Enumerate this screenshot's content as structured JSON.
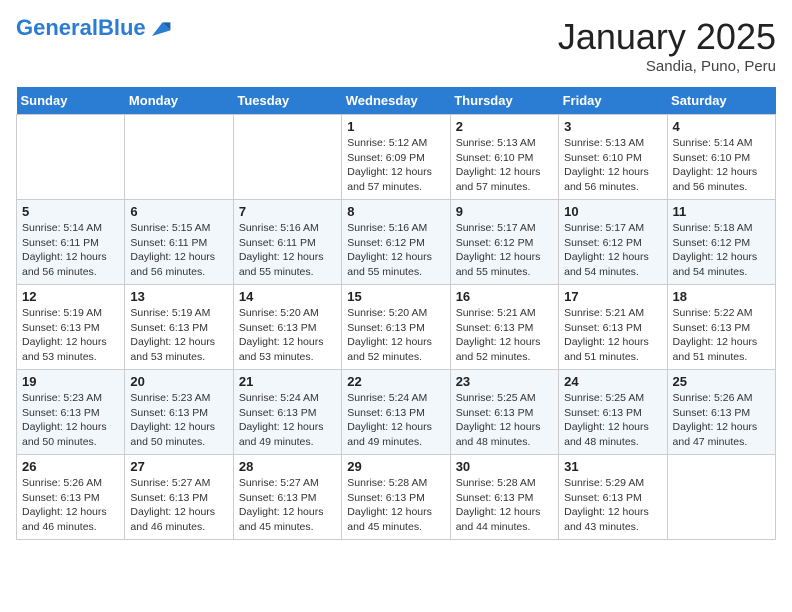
{
  "header": {
    "logo_general": "General",
    "logo_blue": "Blue",
    "month_title": "January 2025",
    "subtitle": "Sandia, Puno, Peru"
  },
  "weekdays": [
    "Sunday",
    "Monday",
    "Tuesday",
    "Wednesday",
    "Thursday",
    "Friday",
    "Saturday"
  ],
  "weeks": [
    [
      {
        "day": "",
        "info": ""
      },
      {
        "day": "",
        "info": ""
      },
      {
        "day": "",
        "info": ""
      },
      {
        "day": "1",
        "info": "Sunrise: 5:12 AM\nSunset: 6:09 PM\nDaylight: 12 hours\nand 57 minutes."
      },
      {
        "day": "2",
        "info": "Sunrise: 5:13 AM\nSunset: 6:10 PM\nDaylight: 12 hours\nand 57 minutes."
      },
      {
        "day": "3",
        "info": "Sunrise: 5:13 AM\nSunset: 6:10 PM\nDaylight: 12 hours\nand 56 minutes."
      },
      {
        "day": "4",
        "info": "Sunrise: 5:14 AM\nSunset: 6:10 PM\nDaylight: 12 hours\nand 56 minutes."
      }
    ],
    [
      {
        "day": "5",
        "info": "Sunrise: 5:14 AM\nSunset: 6:11 PM\nDaylight: 12 hours\nand 56 minutes."
      },
      {
        "day": "6",
        "info": "Sunrise: 5:15 AM\nSunset: 6:11 PM\nDaylight: 12 hours\nand 56 minutes."
      },
      {
        "day": "7",
        "info": "Sunrise: 5:16 AM\nSunset: 6:11 PM\nDaylight: 12 hours\nand 55 minutes."
      },
      {
        "day": "8",
        "info": "Sunrise: 5:16 AM\nSunset: 6:12 PM\nDaylight: 12 hours\nand 55 minutes."
      },
      {
        "day": "9",
        "info": "Sunrise: 5:17 AM\nSunset: 6:12 PM\nDaylight: 12 hours\nand 55 minutes."
      },
      {
        "day": "10",
        "info": "Sunrise: 5:17 AM\nSunset: 6:12 PM\nDaylight: 12 hours\nand 54 minutes."
      },
      {
        "day": "11",
        "info": "Sunrise: 5:18 AM\nSunset: 6:12 PM\nDaylight: 12 hours\nand 54 minutes."
      }
    ],
    [
      {
        "day": "12",
        "info": "Sunrise: 5:19 AM\nSunset: 6:13 PM\nDaylight: 12 hours\nand 53 minutes."
      },
      {
        "day": "13",
        "info": "Sunrise: 5:19 AM\nSunset: 6:13 PM\nDaylight: 12 hours\nand 53 minutes."
      },
      {
        "day": "14",
        "info": "Sunrise: 5:20 AM\nSunset: 6:13 PM\nDaylight: 12 hours\nand 53 minutes."
      },
      {
        "day": "15",
        "info": "Sunrise: 5:20 AM\nSunset: 6:13 PM\nDaylight: 12 hours\nand 52 minutes."
      },
      {
        "day": "16",
        "info": "Sunrise: 5:21 AM\nSunset: 6:13 PM\nDaylight: 12 hours\nand 52 minutes."
      },
      {
        "day": "17",
        "info": "Sunrise: 5:21 AM\nSunset: 6:13 PM\nDaylight: 12 hours\nand 51 minutes."
      },
      {
        "day": "18",
        "info": "Sunrise: 5:22 AM\nSunset: 6:13 PM\nDaylight: 12 hours\nand 51 minutes."
      }
    ],
    [
      {
        "day": "19",
        "info": "Sunrise: 5:23 AM\nSunset: 6:13 PM\nDaylight: 12 hours\nand 50 minutes."
      },
      {
        "day": "20",
        "info": "Sunrise: 5:23 AM\nSunset: 6:13 PM\nDaylight: 12 hours\nand 50 minutes."
      },
      {
        "day": "21",
        "info": "Sunrise: 5:24 AM\nSunset: 6:13 PM\nDaylight: 12 hours\nand 49 minutes."
      },
      {
        "day": "22",
        "info": "Sunrise: 5:24 AM\nSunset: 6:13 PM\nDaylight: 12 hours\nand 49 minutes."
      },
      {
        "day": "23",
        "info": "Sunrise: 5:25 AM\nSunset: 6:13 PM\nDaylight: 12 hours\nand 48 minutes."
      },
      {
        "day": "24",
        "info": "Sunrise: 5:25 AM\nSunset: 6:13 PM\nDaylight: 12 hours\nand 48 minutes."
      },
      {
        "day": "25",
        "info": "Sunrise: 5:26 AM\nSunset: 6:13 PM\nDaylight: 12 hours\nand 47 minutes."
      }
    ],
    [
      {
        "day": "26",
        "info": "Sunrise: 5:26 AM\nSunset: 6:13 PM\nDaylight: 12 hours\nand 46 minutes."
      },
      {
        "day": "27",
        "info": "Sunrise: 5:27 AM\nSunset: 6:13 PM\nDaylight: 12 hours\nand 46 minutes."
      },
      {
        "day": "28",
        "info": "Sunrise: 5:27 AM\nSunset: 6:13 PM\nDaylight: 12 hours\nand 45 minutes."
      },
      {
        "day": "29",
        "info": "Sunrise: 5:28 AM\nSunset: 6:13 PM\nDaylight: 12 hours\nand 45 minutes."
      },
      {
        "day": "30",
        "info": "Sunrise: 5:28 AM\nSunset: 6:13 PM\nDaylight: 12 hours\nand 44 minutes."
      },
      {
        "day": "31",
        "info": "Sunrise: 5:29 AM\nSunset: 6:13 PM\nDaylight: 12 hours\nand 43 minutes."
      },
      {
        "day": "",
        "info": ""
      }
    ]
  ]
}
